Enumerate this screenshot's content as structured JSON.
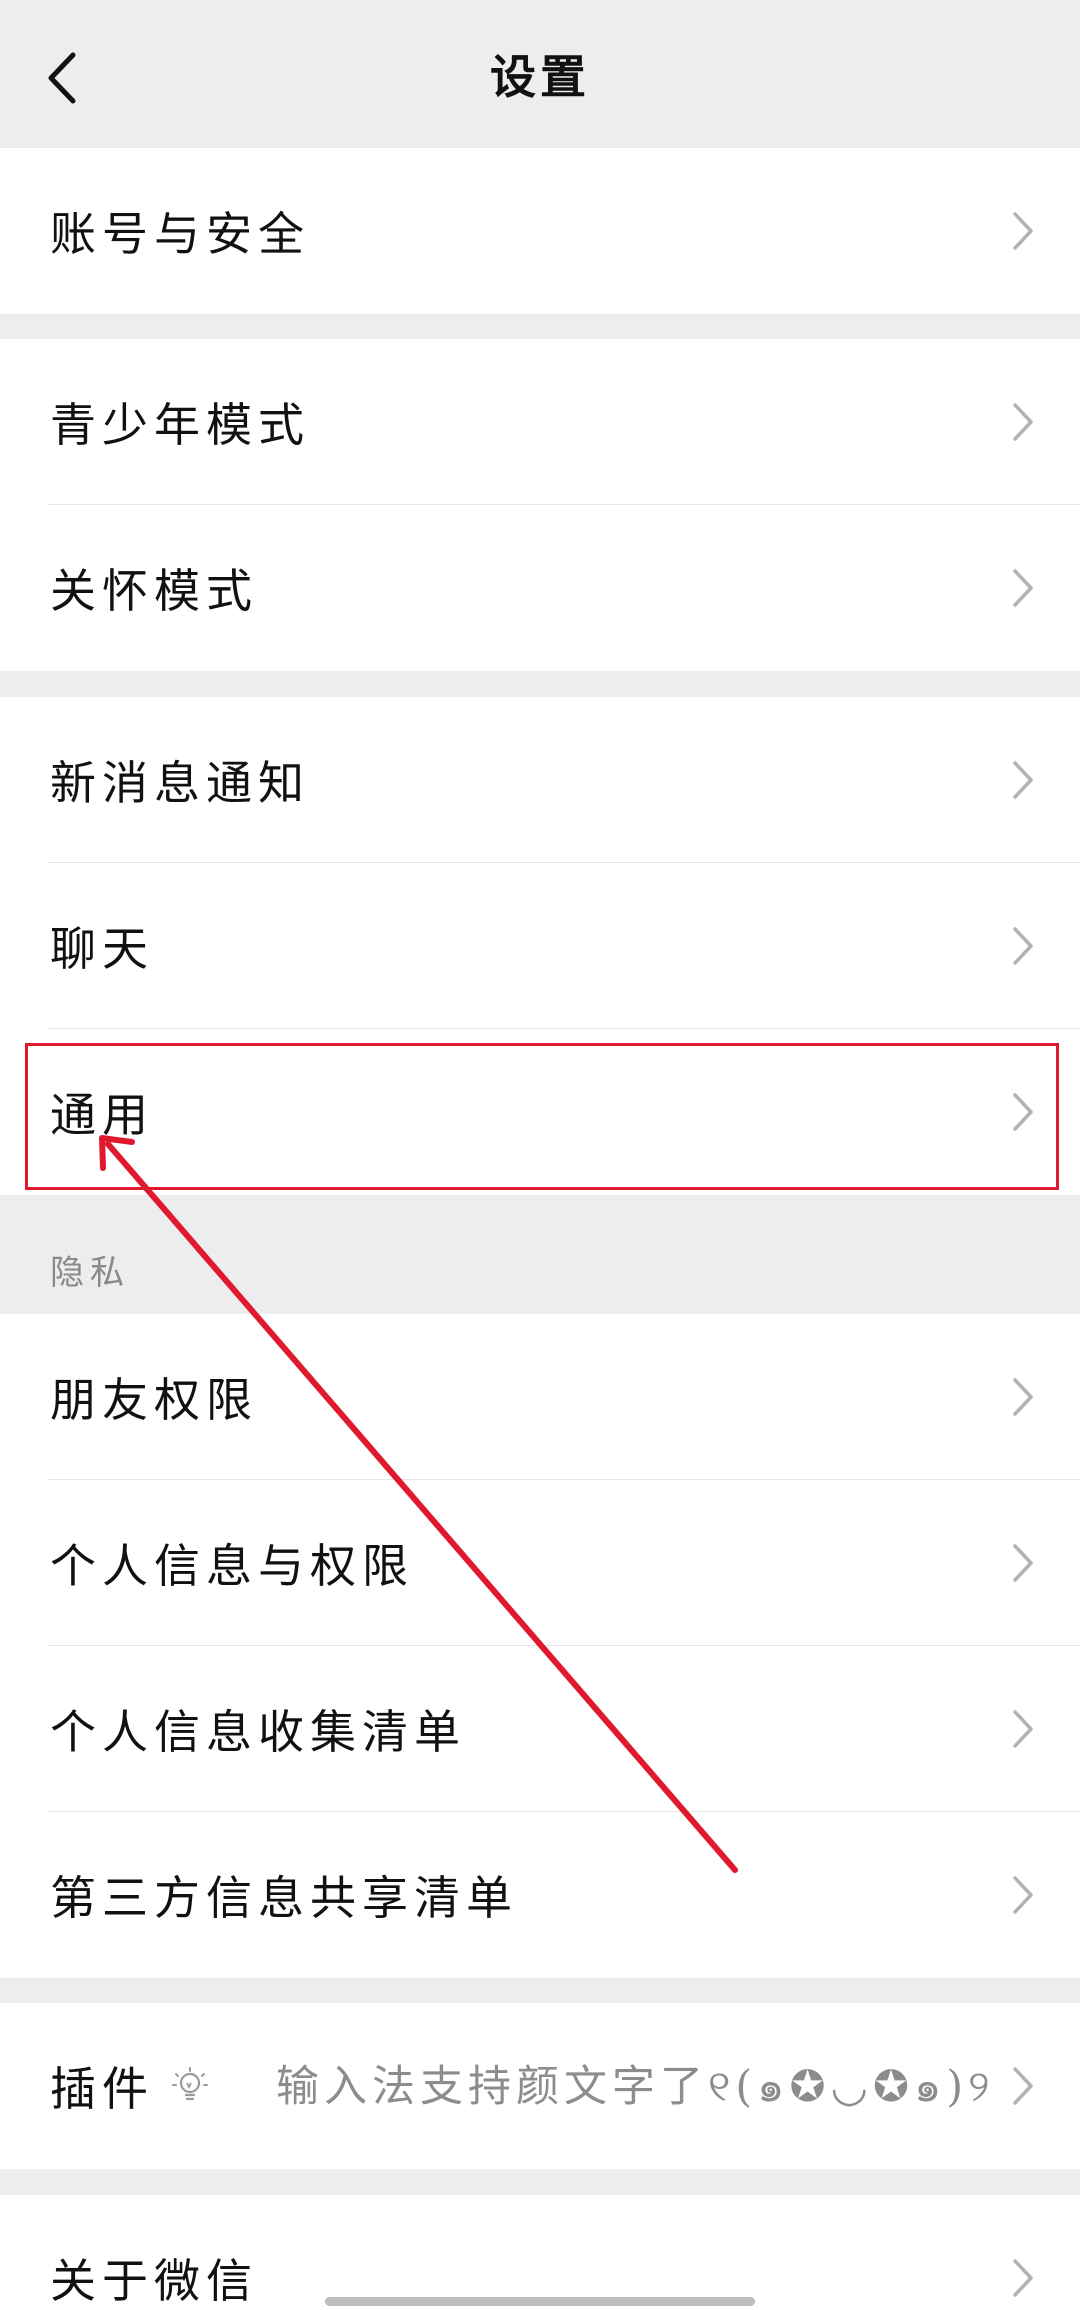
{
  "header": {
    "title": "设置",
    "back_icon": "chevron-left-icon"
  },
  "groups": {
    "account": {
      "items": [
        {
          "label": "账号与安全"
        }
      ]
    },
    "mode": {
      "items": [
        {
          "label": "青少年模式"
        },
        {
          "label": "关怀模式"
        }
      ]
    },
    "general": {
      "items": [
        {
          "label": "新消息通知"
        },
        {
          "label": "聊天"
        },
        {
          "label": "通用"
        }
      ]
    },
    "privacy": {
      "section_label": "隐私",
      "items": [
        {
          "label": "朋友权限"
        },
        {
          "label": "个人信息与权限"
        },
        {
          "label": "个人信息收集清单"
        },
        {
          "label": "第三方信息共享清单"
        }
      ]
    },
    "plugins": {
      "label": "插件",
      "icon": "lightbulb-icon",
      "hint": "输入法支持颜文字了୧(๑✪◡✪๑)୨"
    },
    "about": {
      "items": [
        {
          "label": "关于微信"
        }
      ]
    }
  },
  "annotation": {
    "highlight_color": "#e0192e",
    "target": "通用"
  },
  "colors": {
    "background": "#ededed",
    "card": "#ffffff",
    "secondary_text": "#8c8c8c",
    "chevron": "#b2b2b2"
  }
}
